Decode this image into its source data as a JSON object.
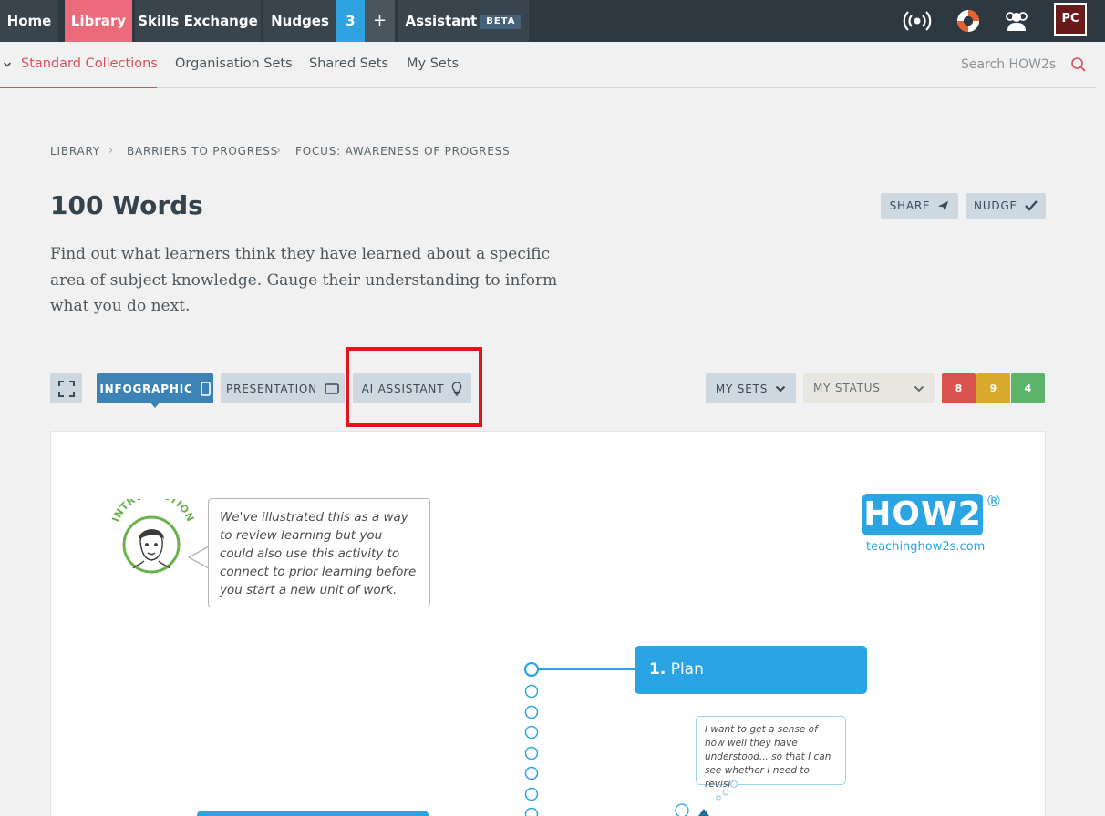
{
  "topnav": {
    "home": "Home",
    "library": "Library",
    "skills_exchange": "Skills Exchange",
    "nudges": "Nudges",
    "nudge_count": "3",
    "plus": "+",
    "assistant": "Assistant",
    "assistant_badge": "BETA",
    "user_initials": "PC"
  },
  "subnav": {
    "items": [
      "Standard Collections",
      "Organisation Sets",
      "Shared Sets",
      "My Sets"
    ],
    "search_label": "Search HOW2s"
  },
  "breadcrumb": [
    "LIBRARY",
    "BARRIERS TO PROGRESS",
    "FOCUS: AWARENESS OF PROGRESS"
  ],
  "page": {
    "title": "100 Words",
    "description": "Find out what learners think they have learned about a specific area of subject knowledge. Gauge their understanding to inform what you do next.",
    "share": "SHARE",
    "nudge": "NUDGE"
  },
  "toolbar": {
    "infographic": "INFOGRAPHIC",
    "presentation": "PRESENTATION",
    "ai_assistant": "AI ASSISTANT",
    "my_sets": "MY SETS",
    "my_status": "MY STATUS",
    "counts": [
      {
        "value": "8",
        "color": "#d9534f"
      },
      {
        "value": "9",
        "color": "#d9a92b"
      },
      {
        "value": "4",
        "color": "#5cb36a"
      }
    ]
  },
  "infographic": {
    "intro_label": "INTRODUCTION",
    "intro_text": "We've illustrated this as a way to review learning but you could also use this activity to connect to prior learning before you start a new unit of work.",
    "logo": "HOW2",
    "logo_reg": "®",
    "logo_url": "teachinghow2s.com",
    "step_number": "1.",
    "step_label": "Plan",
    "thought": "I want to get a sense of how well they have understood... so that I can see whether I need to revisit."
  },
  "colors": {
    "nav_bg": "#2e3840",
    "library_active": "#ec6b7b",
    "accent_blue": "#3d82b4",
    "how2_blue": "#2aa4e3",
    "subnav_active": "#d9505d",
    "highlight": "#e3141c"
  }
}
